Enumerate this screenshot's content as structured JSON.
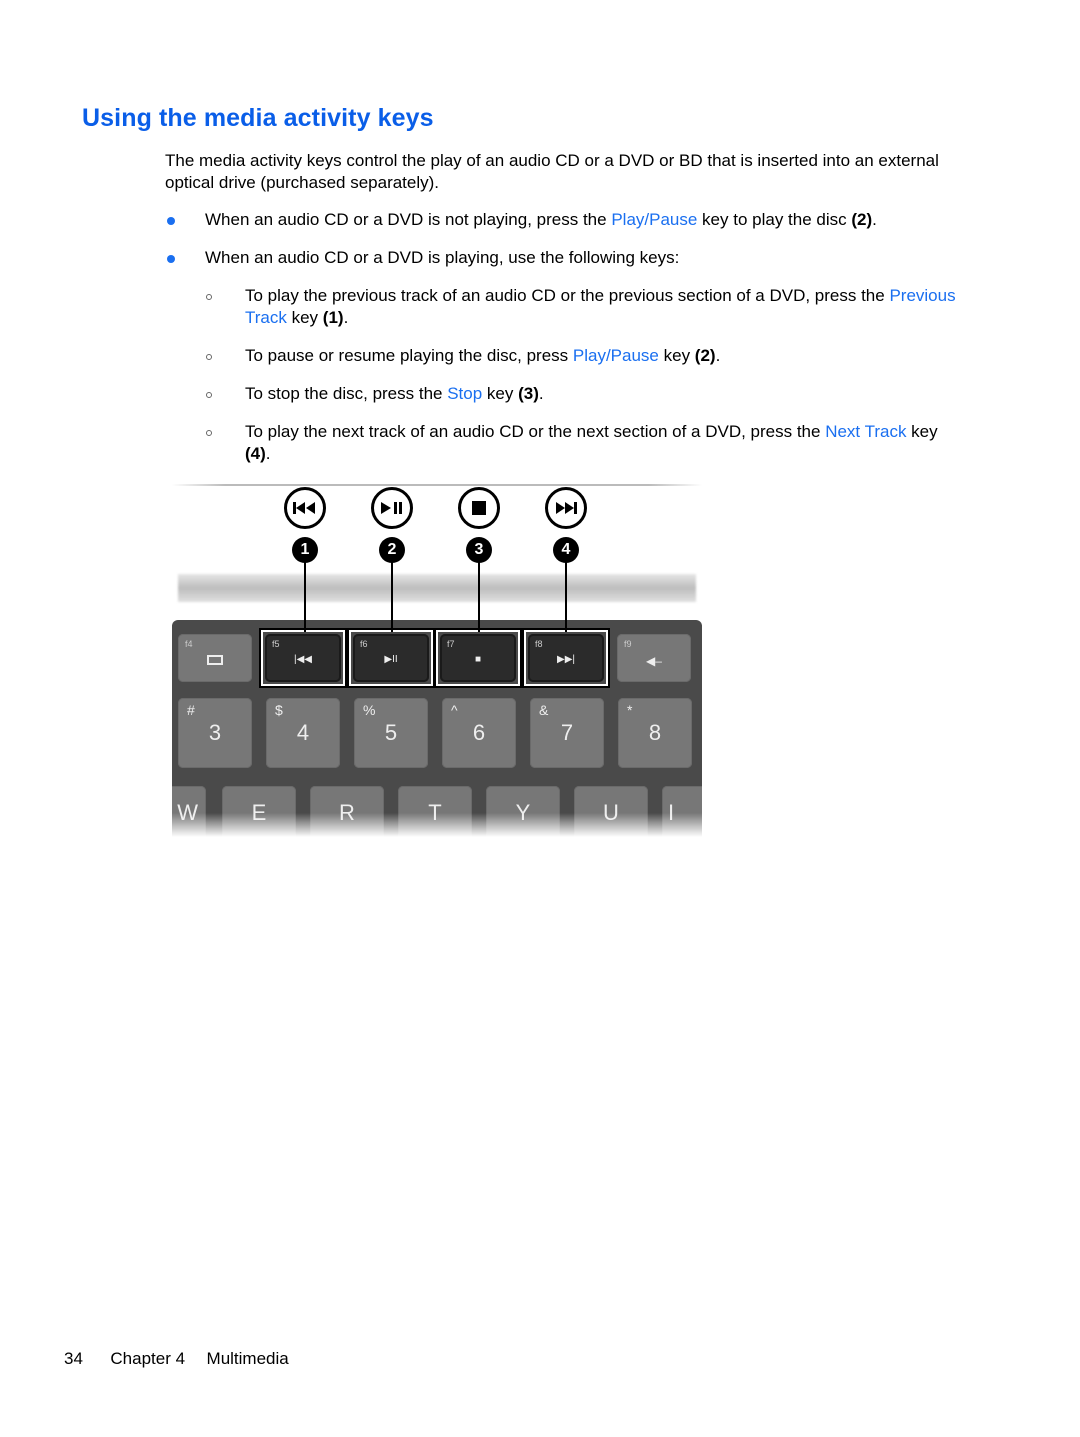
{
  "heading": "Using the media activity keys",
  "intro": "The media activity keys control the play of an audio CD or a DVD or BD that is inserted into an external optical drive (purchased separately).",
  "colors": {
    "heading": "#0a5ee8",
    "link": "#1a6ff0",
    "bullet": "#1a6ff0"
  },
  "bullets": [
    {
      "pre": "When an audio CD or a DVD is not playing, press the ",
      "link": "Play/Pause",
      "post": " key to play the disc ",
      "ref": "(2)",
      "end": "."
    },
    {
      "text": "When an audio CD or a DVD is playing, use the following keys:"
    }
  ],
  "sub_bullets": [
    {
      "pre": "To play the previous track of an audio CD or the previous section of a DVD, press the ",
      "link": "Previous Track",
      "post": " key ",
      "ref": "(1)",
      "end": "."
    },
    {
      "pre": "To pause or resume playing the disc, press ",
      "link": "Play/Pause",
      "post": " key ",
      "ref": "(2)",
      "end": "."
    },
    {
      "pre": "To stop the disc, press the ",
      "link": "Stop",
      "post": " key ",
      "ref": "(3)",
      "end": "."
    },
    {
      "pre": "To play the next track of an audio CD or the next section of a DVD, press the ",
      "link": "Next Track",
      "post": " key ",
      "ref": "(4)",
      "end": "."
    }
  ],
  "figure": {
    "callouts": [
      {
        "number": "1",
        "icon": "previous-track-icon",
        "glyph": "⏮"
      },
      {
        "number": "2",
        "icon": "play-pause-icon",
        "glyph": "⏯"
      },
      {
        "number": "3",
        "icon": "stop-icon",
        "glyph": "■"
      },
      {
        "number": "4",
        "icon": "next-track-icon",
        "glyph": "⏭"
      }
    ],
    "function_keys": [
      {
        "fn": "f4",
        "symbol": "▭"
      },
      {
        "fn": "f5",
        "symbol": "|◀◀"
      },
      {
        "fn": "f6",
        "symbol": "▶II"
      },
      {
        "fn": "f7",
        "symbol": "■"
      },
      {
        "fn": "f8",
        "symbol": "▶▶|"
      },
      {
        "fn": "f9",
        "symbol": "◀–"
      }
    ],
    "number_keys": [
      {
        "shift": "#",
        "main": "3"
      },
      {
        "shift": "$",
        "main": "4"
      },
      {
        "shift": "%",
        "main": "5"
      },
      {
        "shift": "^",
        "main": "6"
      },
      {
        "shift": "&",
        "main": "7"
      },
      {
        "shift": "*",
        "main": "8"
      }
    ],
    "letter_keys": [
      "W",
      "E",
      "R",
      "T",
      "Y",
      "U",
      "I"
    ]
  },
  "footer": {
    "page_number": "34",
    "chapter": "Chapter 4",
    "section": "Multimedia"
  }
}
